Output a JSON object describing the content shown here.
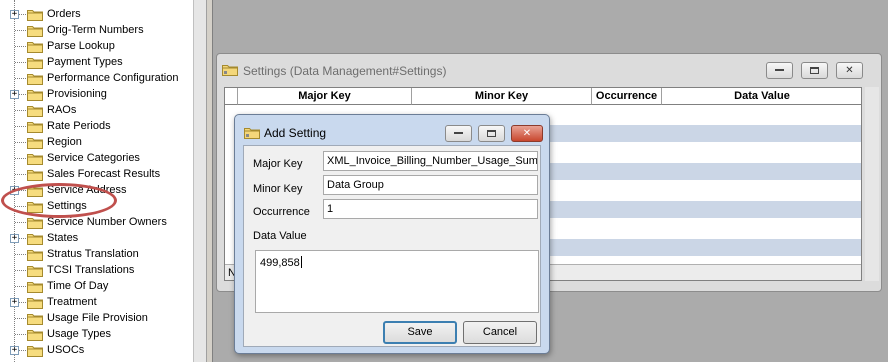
{
  "tree": {
    "items": [
      {
        "label": "Orders",
        "expander": "+"
      },
      {
        "label": "Orig-Term Numbers",
        "expander": ""
      },
      {
        "label": "Parse Lookup",
        "expander": ""
      },
      {
        "label": "Payment Types",
        "expander": ""
      },
      {
        "label": "Performance Configuration",
        "expander": ""
      },
      {
        "label": "Provisioning",
        "expander": "+"
      },
      {
        "label": "RAOs",
        "expander": ""
      },
      {
        "label": "Rate Periods",
        "expander": ""
      },
      {
        "label": "Region",
        "expander": ""
      },
      {
        "label": "Service Categories",
        "expander": ""
      },
      {
        "label": "Sales Forecast Results",
        "expander": ""
      },
      {
        "label": "Service Address",
        "expander": "+"
      },
      {
        "label": "Settings",
        "expander": ""
      },
      {
        "label": "Service Number Owners",
        "expander": ""
      },
      {
        "label": "States",
        "expander": "+"
      },
      {
        "label": "Stratus Translation",
        "expander": ""
      },
      {
        "label": "TCSI Translations",
        "expander": ""
      },
      {
        "label": "Time Of Day",
        "expander": ""
      },
      {
        "label": "Treatment",
        "expander": "+"
      },
      {
        "label": "Usage File Provision",
        "expander": ""
      },
      {
        "label": "Usage Types",
        "expander": ""
      },
      {
        "label": "USOCs",
        "expander": "+"
      }
    ],
    "highlighted_item": "Settings"
  },
  "settings_window": {
    "title": "Settings (Data Management#Settings)",
    "columns": [
      "Major Key",
      "Minor Key",
      "Occurrence",
      "Data Value"
    ],
    "status_text": "N"
  },
  "add_setting_dialog": {
    "title": "Add Setting",
    "major_key_label": "Major Key",
    "major_key_value": "XML_Invoice_Billing_Number_Usage_Summ",
    "minor_key_label": "Minor Key",
    "minor_key_value": "Data Group",
    "occurrence_label": "Occurrence",
    "occurrence_value": "1",
    "data_value_label": "Data Value",
    "data_value_value": "499,858",
    "save_label": "Save",
    "cancel_label": "Cancel"
  },
  "colors": {
    "highlight_ellipse": "#c0504d",
    "grid_band": "#cbd6e6",
    "dialog_frame": "#c9d9ee"
  }
}
